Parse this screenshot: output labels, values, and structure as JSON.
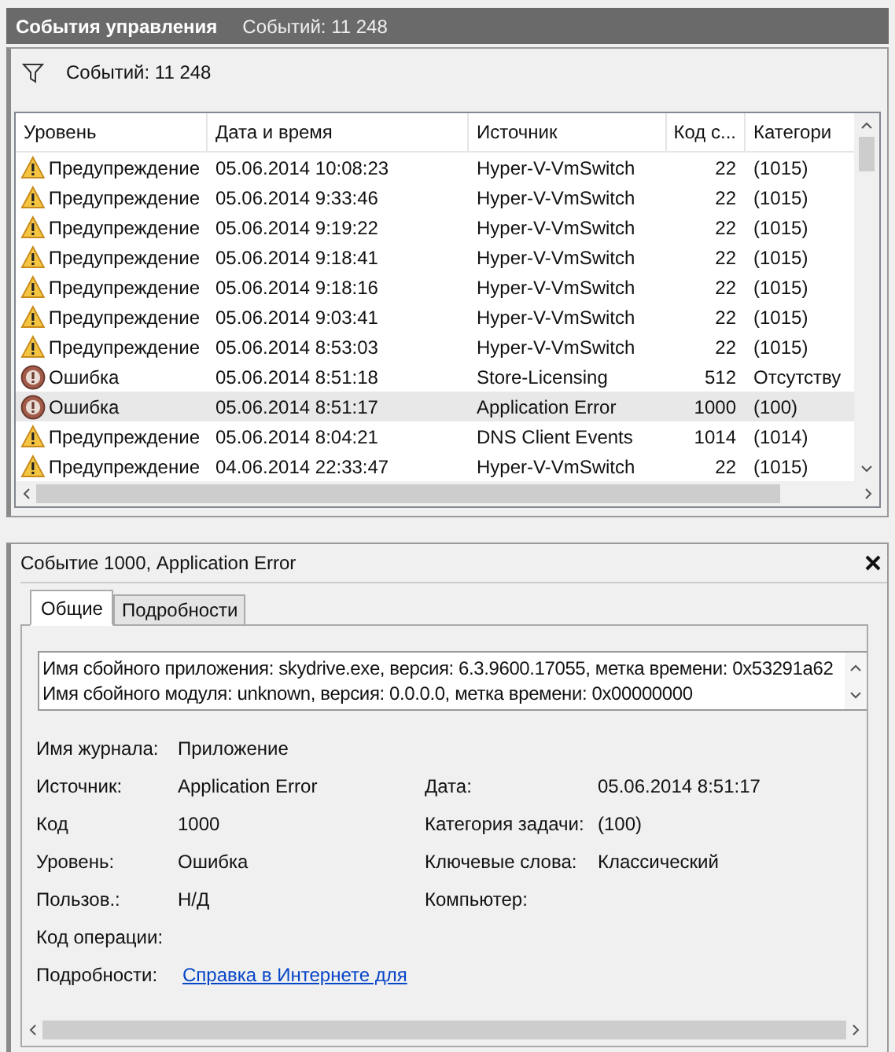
{
  "header": {
    "title": "События управления",
    "count": "Событий: 11 248"
  },
  "filter": {
    "label": "Событий: 11 248"
  },
  "table": {
    "columns": [
      "Уровень",
      "Дата и время",
      "Источник",
      "Код с...",
      "Категори"
    ],
    "rows": [
      {
        "kind": "warning",
        "level": "Предупреждение",
        "datetime": "05.06.2014 10:08:23",
        "source": "Hyper-V-VmSwitch",
        "code": "22",
        "category": "(1015)",
        "selected": false
      },
      {
        "kind": "warning",
        "level": "Предупреждение",
        "datetime": "05.06.2014 9:33:46",
        "source": "Hyper-V-VmSwitch",
        "code": "22",
        "category": "(1015)",
        "selected": false
      },
      {
        "kind": "warning",
        "level": "Предупреждение",
        "datetime": "05.06.2014 9:19:22",
        "source": "Hyper-V-VmSwitch",
        "code": "22",
        "category": "(1015)",
        "selected": false
      },
      {
        "kind": "warning",
        "level": "Предупреждение",
        "datetime": "05.06.2014 9:18:41",
        "source": "Hyper-V-VmSwitch",
        "code": "22",
        "category": "(1015)",
        "selected": false
      },
      {
        "kind": "warning",
        "level": "Предупреждение",
        "datetime": "05.06.2014 9:18:16",
        "source": "Hyper-V-VmSwitch",
        "code": "22",
        "category": "(1015)",
        "selected": false
      },
      {
        "kind": "warning",
        "level": "Предупреждение",
        "datetime": "05.06.2014 9:03:41",
        "source": "Hyper-V-VmSwitch",
        "code": "22",
        "category": "(1015)",
        "selected": false
      },
      {
        "kind": "warning",
        "level": "Предупреждение",
        "datetime": "05.06.2014 8:53:03",
        "source": "Hyper-V-VmSwitch",
        "code": "22",
        "category": "(1015)",
        "selected": false
      },
      {
        "kind": "error",
        "level": "Ошибка",
        "datetime": "05.06.2014 8:51:18",
        "source": "Store-Licensing",
        "code": "512",
        "category": "Отсутству",
        "selected": false
      },
      {
        "kind": "error",
        "level": "Ошибка",
        "datetime": "05.06.2014 8:51:17",
        "source": "Application Error",
        "code": "1000",
        "category": "(100)",
        "selected": true
      },
      {
        "kind": "warning",
        "level": "Предупреждение",
        "datetime": "05.06.2014 8:04:21",
        "source": "DNS Client Events",
        "code": "1014",
        "category": "(1014)",
        "selected": false
      },
      {
        "kind": "warning",
        "level": "Предупреждение",
        "datetime": "04.06.2014 22:33:47",
        "source": "Hyper-V-VmSwitch",
        "code": "22",
        "category": "(1015)",
        "selected": false
      }
    ]
  },
  "details": {
    "title": "Событие 1000, Application Error",
    "tabs": [
      {
        "label": "Общие",
        "selected": true
      },
      {
        "label": "Подробности",
        "selected": false
      }
    ],
    "description": [
      "Имя сбойного приложения: skydrive.exe, версия: 6.3.9600.17055, метка времени: 0x53291a62",
      "Имя сбойного модуля: unknown, версия: 0.0.0.0, метка времени: 0x00000000"
    ],
    "fields": [
      {
        "left": {
          "label": "Имя журнала:",
          "value": "Приложение"
        }
      },
      {
        "left": {
          "label": "Источник:",
          "value": "Application Error"
        },
        "right": {
          "label": "Дата:",
          "value": "05.06.2014 8:51:17"
        }
      },
      {
        "left": {
          "label": "Код",
          "value": "1000"
        },
        "right": {
          "label": "Категория задачи:",
          "value": "(100)"
        }
      },
      {
        "left": {
          "label": "Уровень:",
          "value": "Ошибка"
        },
        "right": {
          "label": "Ключевые слова:",
          "value": "Классический"
        }
      },
      {
        "left": {
          "label": "Пользов.:",
          "value": "Н/Д"
        },
        "right": {
          "label": "Компьютер:"
        }
      },
      {
        "left": {
          "label": "Код операции:"
        }
      },
      {
        "left": {
          "label": "Подробности:",
          "value": "Справка в Интернете для",
          "kind": "link"
        }
      }
    ]
  }
}
